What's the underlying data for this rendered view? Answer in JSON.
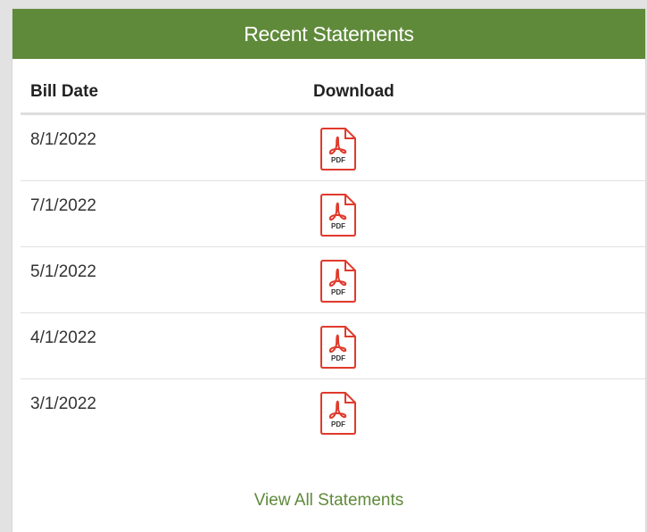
{
  "panel": {
    "title": "Recent Statements",
    "accent_color": "#5f8a3a"
  },
  "columns": {
    "bill_date": "Bill Date",
    "download": "Download"
  },
  "statements": [
    {
      "bill_date": "8/1/2022",
      "download_icon": "pdf-icon",
      "download_icon_text": "PDF"
    },
    {
      "bill_date": "7/1/2022",
      "download_icon": "pdf-icon",
      "download_icon_text": "PDF"
    },
    {
      "bill_date": "5/1/2022",
      "download_icon": "pdf-icon",
      "download_icon_text": "PDF"
    },
    {
      "bill_date": "4/1/2022",
      "download_icon": "pdf-icon",
      "download_icon_text": "PDF"
    },
    {
      "bill_date": "3/1/2022",
      "download_icon": "pdf-icon",
      "download_icon_text": "PDF"
    }
  ],
  "footer": {
    "view_all_label": "View All Statements"
  }
}
